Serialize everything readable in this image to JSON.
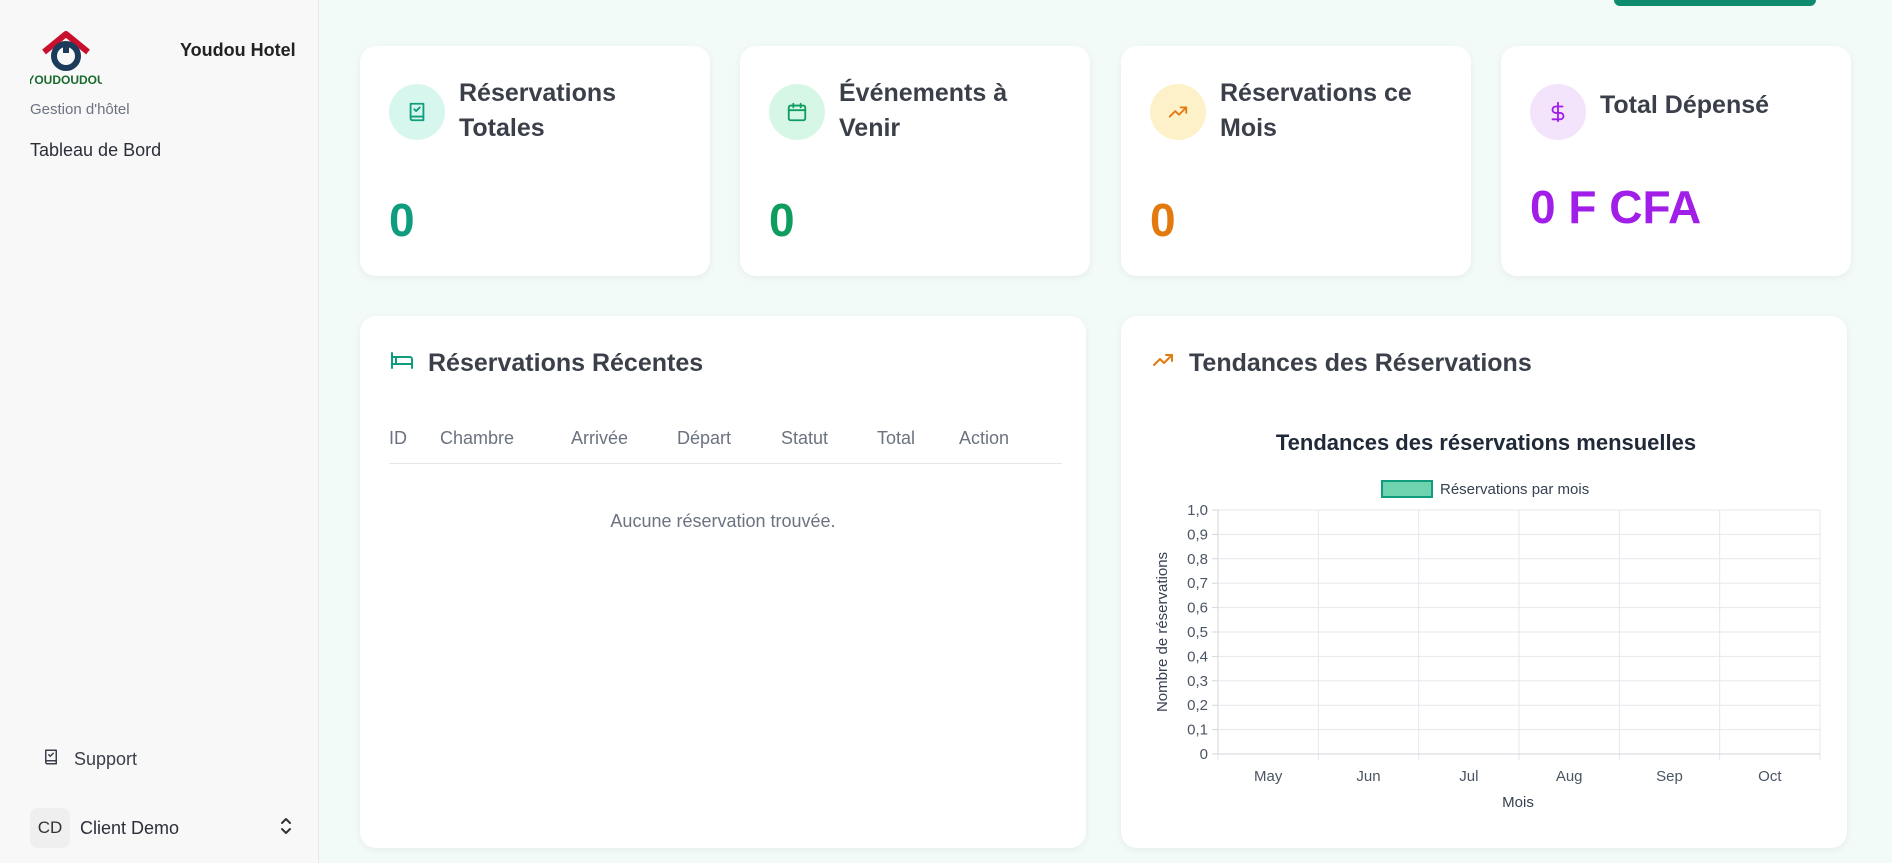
{
  "sidebar": {
    "brand_name": "Youdou Hotel",
    "logo_text": "YOUDOUDOU",
    "group_label": "Gestion d'hôtel",
    "dashboard_label": "Tableau de Bord",
    "support_label": "Support",
    "user_initials": "CD",
    "user_name": "Client Demo"
  },
  "stats": [
    {
      "title": "Réservations Totales",
      "value": "0",
      "color": "#0f9d7e",
      "icon_bg": "#d7f7ee",
      "icon": "book-check-icon"
    },
    {
      "title": "Événements à Venir",
      "value": "0",
      "color": "#0f9d5f",
      "icon_bg": "#d7f7e6",
      "icon": "calendar-icon"
    },
    {
      "title": "Réservations ce Mois",
      "value": "0",
      "color": "#e27a10",
      "icon_bg": "#fdf1c9",
      "icon": "trending-up-icon"
    },
    {
      "title": "Total Dépensé",
      "value": "0 F CFA",
      "color": "#a11ee8",
      "icon_bg": "#f3e3fb",
      "icon": "dollar-icon"
    }
  ],
  "recent": {
    "title": "Réservations Récentes",
    "columns": [
      "ID",
      "Chambre",
      "Arrivée",
      "Départ",
      "Statut",
      "Total",
      "Action"
    ],
    "empty_text": "Aucune réservation trouvée."
  },
  "trends": {
    "title": "Tendances des Réservations"
  },
  "chart_data": {
    "type": "bar",
    "title": "Tendances des réservations mensuelles",
    "categories": [
      "May",
      "Jun",
      "Jul",
      "Aug",
      "Sep",
      "Oct"
    ],
    "series": [
      {
        "name": "Réservations par mois",
        "values": [
          0,
          0,
          0,
          0,
          0,
          0
        ],
        "color": "#6fd3b0"
      }
    ],
    "xlabel": "Mois",
    "ylabel": "Nombre de réservations",
    "ylim": [
      0,
      1
    ],
    "yticks": [
      "0",
      "0,1",
      "0,2",
      "0,3",
      "0,4",
      "0,5",
      "0,6",
      "0,7",
      "0,8",
      "0,9",
      "1,0"
    ],
    "grid": true,
    "legend": "top"
  }
}
